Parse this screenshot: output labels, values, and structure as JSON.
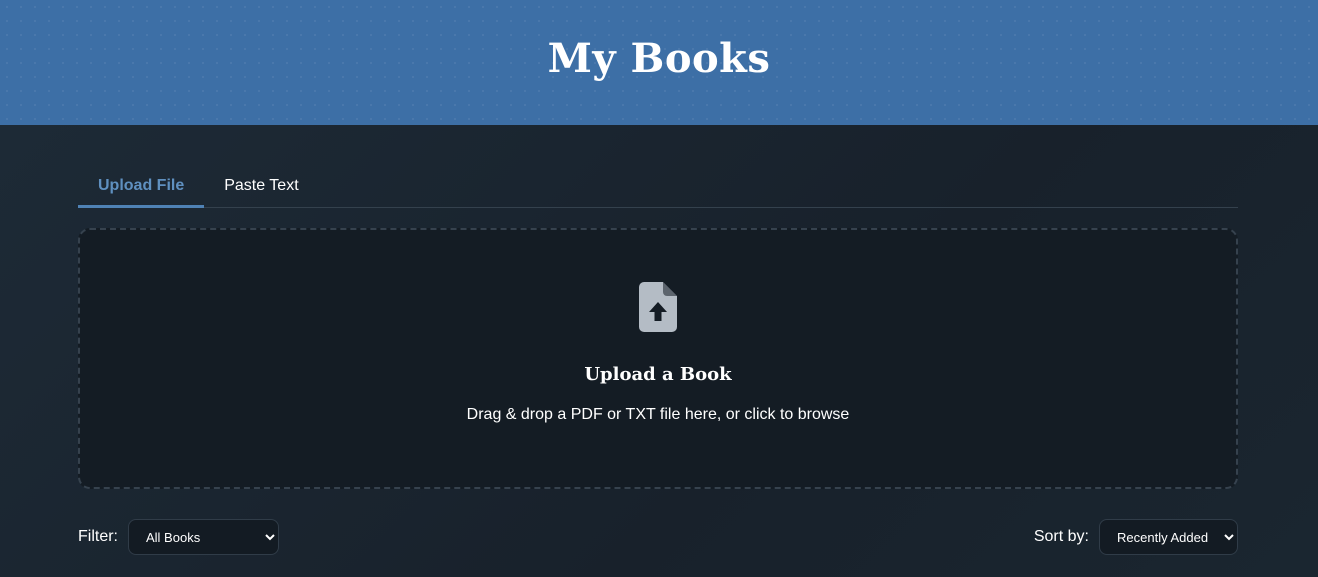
{
  "header": {
    "title": "My Books"
  },
  "tabs": [
    {
      "label": "Upload File",
      "active": true
    },
    {
      "label": "Paste Text",
      "active": false
    }
  ],
  "dropzone": {
    "icon": "file-upload-icon",
    "title": "Upload a Book",
    "subtitle": "Drag & drop a PDF or TXT file here, or click to browse"
  },
  "filter": {
    "label": "Filter:",
    "selected": "All Books"
  },
  "sort": {
    "label": "Sort by:",
    "selected": "Recently Added"
  },
  "colors": {
    "header_bg": "#3d6fa6",
    "page_bg": "#1b2631",
    "accent": "#5f90c0",
    "dropzone_bg": "#141c24"
  }
}
